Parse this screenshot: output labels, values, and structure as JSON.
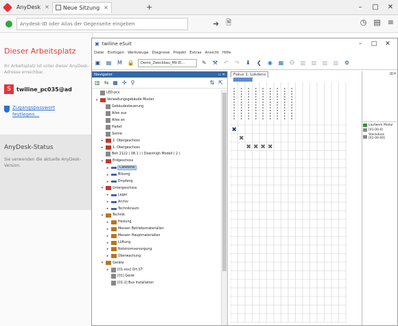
{
  "anydesk": {
    "tab_title": "AnyDesk",
    "tab2_title": "Neue Sitzung",
    "new_tab": "+",
    "address_placeholder": "Anydesk-ID oder Alias der Gegenseite eingeben",
    "left_title": "Dieser Arbeitsplatz",
    "left_desc": "Ihr Arbeitsplatz ist unter dieser AnyDesk-Adresse erreichbar.",
    "desk_id": "twiline_pc035@ad",
    "password_link": "Zugangspasswort festlegen...",
    "status_title": "AnyDesk-Status",
    "status_text": "Sie verwenden die aktuelle AnyDesk-Version."
  },
  "twiline": {
    "title": "twiline eSuit",
    "menu": [
      "Datei",
      "Einfügen",
      "Werkzeuge",
      "Diagnose",
      "Projekt",
      "Extras",
      "Ansicht",
      "Hilfe"
    ],
    "combo_value": "Demo_Zweckbau_Mit El...",
    "navigator_title": "Navigator",
    "matrix_tab": "Fokus 1: Lokdens",
    "tree": [
      {
        "indent": 0,
        "exp": "",
        "icon": "plan",
        "label": "LED-pcs"
      },
      {
        "indent": 0,
        "exp": "-",
        "icon": "redfolder",
        "label": "Verwaltungsgebäude Muster"
      },
      {
        "indent": 1,
        "exp": "",
        "icon": "plan",
        "label": "Gebäudesteuerung"
      },
      {
        "indent": 1,
        "exp": "",
        "icon": "plan",
        "label": "Alles aus"
      },
      {
        "indent": 1,
        "exp": "",
        "icon": "plan",
        "label": "Alles an"
      },
      {
        "indent": 1,
        "exp": "",
        "icon": "plan",
        "label": "Haltet"
      },
      {
        "indent": 1,
        "exp": "",
        "icon": "plan",
        "label": "Sonne"
      },
      {
        "indent": 1,
        "exp": "+",
        "icon": "redfolder",
        "label": "2. Obergeschoss"
      },
      {
        "indent": 1,
        "exp": "+",
        "icon": "redfolder",
        "label": "1. Obergeschoss"
      },
      {
        "indent": 1,
        "exp": "",
        "icon": "plan",
        "label": "Beh 2122 ( 08.1 ) ( Downhigh Modell ( 2 )"
      },
      {
        "indent": 1,
        "exp": "-",
        "icon": "redfolder",
        "label": "Erdgeschoss"
      },
      {
        "indent": 2,
        "exp": "+",
        "icon": "arrow",
        "label": "Cafeteria",
        "selected": true
      },
      {
        "indent": 2,
        "exp": "+",
        "icon": "arrow",
        "label": "Bilsong"
      },
      {
        "indent": 2,
        "exp": "+",
        "icon": "arrow",
        "label": "Empfang"
      },
      {
        "indent": 1,
        "exp": "-",
        "icon": "redfolder",
        "label": "Untergeschoss"
      },
      {
        "indent": 2,
        "exp": "+",
        "icon": "arrow",
        "label": "Lager"
      },
      {
        "indent": 2,
        "exp": "+",
        "icon": "arrow",
        "label": "Archiv"
      },
      {
        "indent": 2,
        "exp": "+",
        "icon": "arrow",
        "label": "Technikraum"
      },
      {
        "indent": 1,
        "exp": "-",
        "icon": "folder",
        "label": "Technik"
      },
      {
        "indent": 2,
        "exp": "+",
        "icon": "folder",
        "label": "Heizung"
      },
      {
        "indent": 2,
        "exp": "+",
        "icon": "folder",
        "label": "Messen Betriebsmaterialien"
      },
      {
        "indent": 2,
        "exp": "+",
        "icon": "folder",
        "label": "Messen Hauptmaterialien"
      },
      {
        "indent": 2,
        "exp": "+",
        "icon": "folder",
        "label": "Lüftung"
      },
      {
        "indent": 2,
        "exp": "+",
        "icon": "folder",
        "label": "Notstromversorgung"
      },
      {
        "indent": 2,
        "exp": "+",
        "icon": "folder",
        "label": "Überwachung"
      },
      {
        "indent": 1,
        "exp": "-",
        "icon": "folder",
        "label": "Geräte"
      },
      {
        "indent": 2,
        "exp": "+",
        "icon": "plan",
        "label": "[01-xxx] Ort.ST"
      },
      {
        "indent": 2,
        "exp": "",
        "icon": "plan",
        "label": "[01] Gerät"
      },
      {
        "indent": 2,
        "exp": "",
        "icon": "plan",
        "label": "[01-1] Bus Installation"
      }
    ],
    "right_panel_items": [
      {
        "icon": "green",
        "label": "Laufwerk Modul"
      },
      {
        "icon": "grey",
        "label": "[01-00-0]"
      },
      {
        "icon": "grey",
        "label": "Steckdose\n[01-00-00]"
      }
    ]
  }
}
